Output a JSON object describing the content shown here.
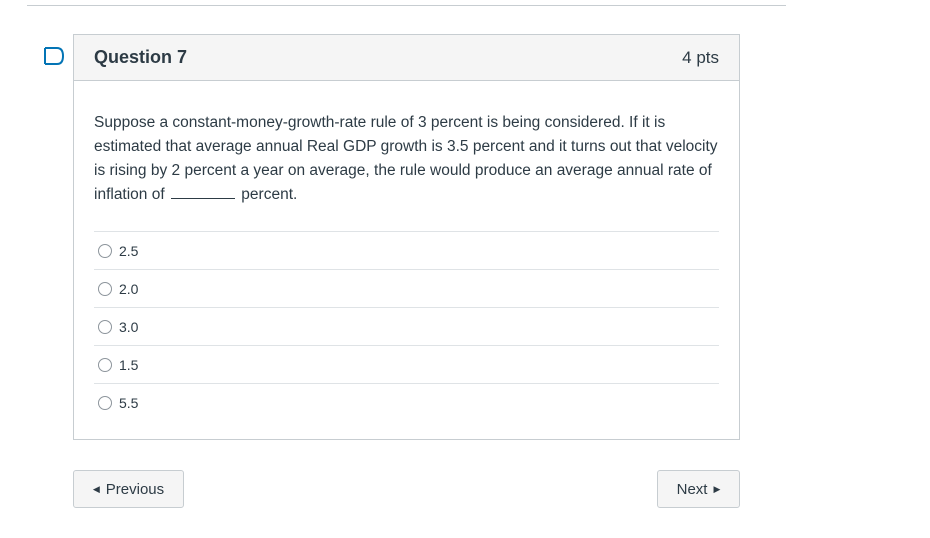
{
  "question": {
    "title": "Question 7",
    "points": "4 pts",
    "text_before_blank": "Suppose a constant-money-growth-rate rule of 3 percent is being considered. If it is estimated that average annual Real GDP growth is 3.5 percent and it turns out that velocity is rising by 2 percent a year on average, the rule would produce an average annual rate of inflation of",
    "text_after_blank": "percent.",
    "answers": [
      {
        "label": "2.5"
      },
      {
        "label": "2.0"
      },
      {
        "label": "3.0"
      },
      {
        "label": "1.5"
      },
      {
        "label": "5.5"
      }
    ]
  },
  "navigation": {
    "previous_label": "Previous",
    "next_label": "Next"
  },
  "icons": {
    "flag": "flag-icon",
    "previous": "triangle-left-icon",
    "next": "triangle-right-icon"
  },
  "colors": {
    "accent": "#0374b5",
    "border": "#c7cdd1",
    "header_bg": "#f5f5f5",
    "text": "#2d3b45"
  }
}
